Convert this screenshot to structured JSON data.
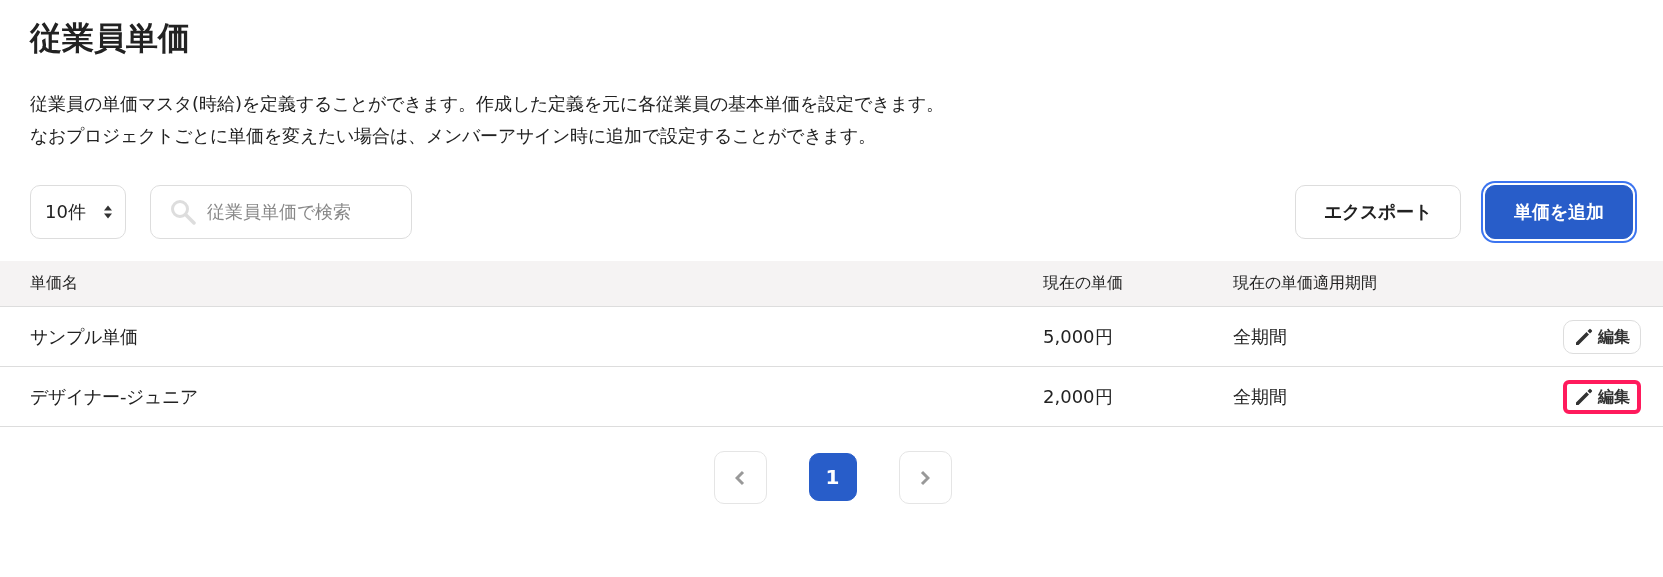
{
  "title": "従業員単価",
  "description": [
    "従業員の単価マスタ(時給)を定義することができます。作成した定義を元に各従業員の基本単価を設定できます。",
    "なおプロジェクトごとに単価を変えたい場合は、メンバーアサイン時に追加で設定することができます。"
  ],
  "page_size": {
    "value": "10件"
  },
  "search": {
    "placeholder": "従業員単価で検索"
  },
  "buttons": [
    {
      "label": "エクスポート",
      "kind": "outline",
      "focused": false
    },
    {
      "label": "単価を追加",
      "kind": "primary",
      "focused": true
    }
  ],
  "table": {
    "columns": [
      "単価名",
      "現在の単価",
      "現在の単価適用期間"
    ],
    "rows": [
      {
        "name": "サンプル単価",
        "price": "5,000円",
        "period": "全期間",
        "action": "編集",
        "highlighted": false
      },
      {
        "name": "デザイナー-ジュニア",
        "price": "2,000円",
        "period": "全期間",
        "action": "編集",
        "highlighted": true
      }
    ]
  },
  "pagination": {
    "prev": {
      "disabled": true
    },
    "pages": [
      {
        "label": "1",
        "selected": true
      }
    ],
    "next": {
      "disabled": true
    }
  }
}
